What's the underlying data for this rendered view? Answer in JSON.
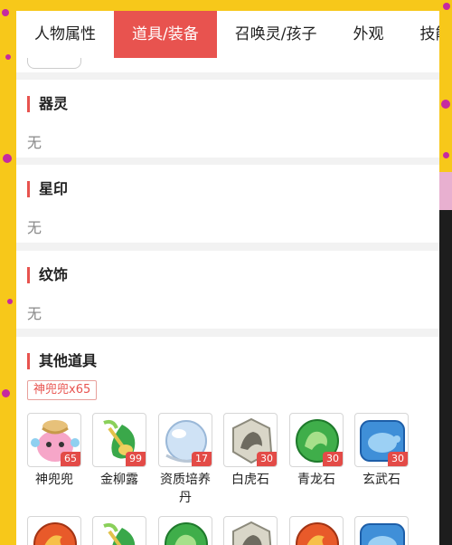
{
  "tabs": [
    {
      "label": "人物属性",
      "active": false
    },
    {
      "label": "道具/装备",
      "active": true
    },
    {
      "label": "召唤灵/孩子",
      "active": false
    },
    {
      "label": "外观",
      "active": false
    },
    {
      "label": "技能",
      "active": false
    }
  ],
  "sections": {
    "qiling": {
      "title": "器灵",
      "value": "无"
    },
    "xingyin": {
      "title": "星印",
      "value": "无"
    },
    "wenshi": {
      "title": "纹饰",
      "value": "无"
    },
    "other": {
      "title": "其他道具",
      "tag": "神兜兜x65",
      "items": [
        {
          "name": "神兜兜",
          "count": "65",
          "icon": "pouch-icon"
        },
        {
          "name": "金柳露",
          "count": "99",
          "icon": "willow-dew-icon"
        },
        {
          "name": "资质培养丹",
          "count": "17",
          "icon": "pearl-icon"
        },
        {
          "name": "白虎石",
          "count": "30",
          "icon": "white-tiger-stone-icon"
        },
        {
          "name": "青龙石",
          "count": "30",
          "icon": "azure-dragon-stone-icon"
        },
        {
          "name": "玄武石",
          "count": "30",
          "icon": "black-tortoise-stone-icon"
        }
      ],
      "row2_icons": [
        "phoenix-stone-icon",
        "willow-dew-icon",
        "azure-dragon-stone-icon",
        "white-tiger-stone-icon",
        "phoenix-stone-icon",
        "black-tortoise-stone-icon"
      ]
    }
  },
  "colors": {
    "accent": "#e8534f",
    "background": "#f7c81a"
  }
}
